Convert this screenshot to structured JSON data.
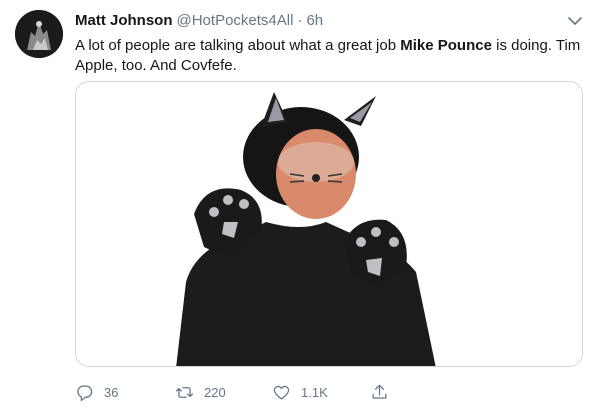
{
  "tweet": {
    "display_name": "Matt Johnson",
    "handle": "@HotPockets4All",
    "separator": "·",
    "time": "6h",
    "text_before": "A lot of people are talking about what a great job ",
    "text_bold": "Mike Pounce",
    "text_after": " is doing. Tim Apple, too. And Covfefe."
  },
  "icons": {
    "avatar": "avatar-image",
    "menu": "chevron-down-icon",
    "reply": "reply-icon",
    "retweet": "retweet-icon",
    "like": "heart-icon",
    "share": "share-icon"
  },
  "actions": {
    "replies": "36",
    "retweets": "220",
    "likes": "1.1K"
  },
  "colors": {
    "text": "#14171a",
    "secondary": "#657786",
    "border": "#ccd6dd"
  }
}
